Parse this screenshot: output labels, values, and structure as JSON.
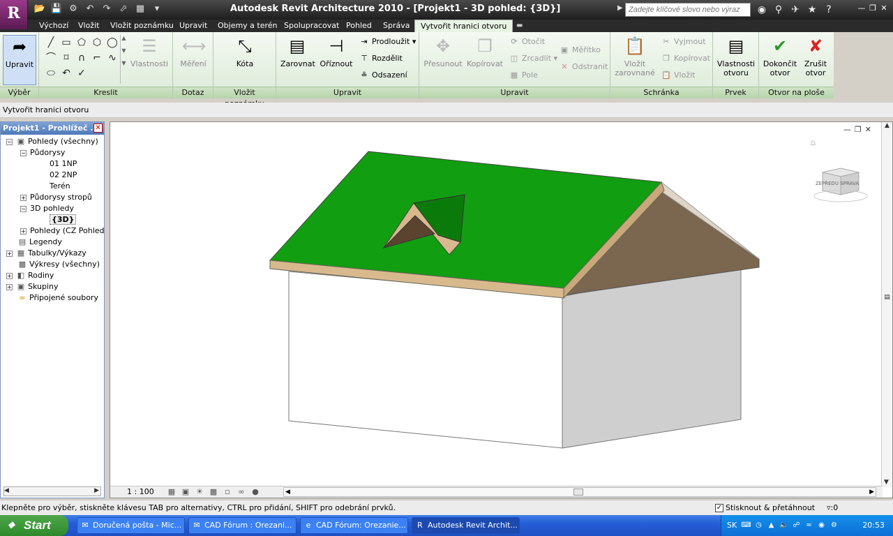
{
  "titlebar": {
    "app_logo": "R",
    "title": "Autodesk Revit Architecture 2010 - [Projekt1 - 3D pohled: {3D}]",
    "search_placeholder": "Zadejte klíčové slovo nebo výraz",
    "icons": [
      "binoculars-icon",
      "key-icon",
      "satellite-icon",
      "star-icon",
      "help-icon"
    ]
  },
  "tabs": [
    {
      "label": "Výchozí",
      "active": false
    },
    {
      "label": "Vložit",
      "active": false
    },
    {
      "label": "Vložit poznámku",
      "active": false
    },
    {
      "label": "Upravit",
      "active": false
    },
    {
      "label": "Objemy a terén",
      "active": false
    },
    {
      "label": "Spolupracovat",
      "active": false
    },
    {
      "label": "Pohled",
      "active": false
    },
    {
      "label": "Správa",
      "active": false
    },
    {
      "label": "Vytvořit hranici otvoru",
      "active": true
    }
  ],
  "ribbon": {
    "select": {
      "label": "Výběr",
      "modify": "Upravit"
    },
    "draw": {
      "label": "Kreslit",
      "properties": "Vlastnosti"
    },
    "inquiry": {
      "label": "Dotaz",
      "measure": "Měření"
    },
    "annotate": {
      "label": "Vložit poznámku",
      "dimension": "Kóta"
    },
    "edit": {
      "label": "Upravit",
      "align": "Zarovnat",
      "trim": "Oříznout",
      "extend": "Prodloužit",
      "split": "Rozdělit",
      "offset": "Odsazení"
    },
    "edit2": {
      "label": "Upravit",
      "move": "Přesunout",
      "copy": "Kopírovat",
      "rotate": "Otočit",
      "mirror": "Zrcadlit",
      "array": "Pole",
      "scale": "Měřítko",
      "delete": "Odstranit"
    },
    "clipboard": {
      "label": "Schránka",
      "paste_aligned": "Vložit zarovnané",
      "cut": "Vyjmout",
      "copy": "Kopírovat",
      "paste": "Vložit"
    },
    "element": {
      "label": "Prvek",
      "properties": "Vlastnosti otvoru"
    },
    "opening": {
      "label": "Otvor na ploše",
      "finish": "Dokončit otvor",
      "cancel": "Zrušit otvor"
    }
  },
  "optionsbar": {
    "text": "Vytvořit hranici otvoru"
  },
  "browser": {
    "title": "Projekt1 - Prohlížeč ...",
    "items": [
      {
        "label": "Pohledy (všechny)",
        "toggle": "−"
      },
      {
        "label": "Půdorysy",
        "toggle": "−"
      },
      {
        "label": "01 1NP"
      },
      {
        "label": "02 2NP"
      },
      {
        "label": "Terén"
      },
      {
        "label": "Půdorysy stropů",
        "toggle": "+"
      },
      {
        "label": "3D pohledy",
        "toggle": "−"
      },
      {
        "label": "{3D}"
      },
      {
        "label": "Pohledy (CZ Pohledy)",
        "toggle": "+"
      },
      {
        "label": "Legendy"
      },
      {
        "label": "Tabulky/Výkazy",
        "toggle": "+"
      },
      {
        "label": "Výkresy (všechny)"
      },
      {
        "label": "Rodiny",
        "toggle": "+"
      },
      {
        "label": "Skupiny",
        "toggle": "+"
      },
      {
        "label": "Připojené soubory"
      }
    ]
  },
  "view": {
    "scale": "1 : 100",
    "viewcube_label": "ZEPŘEDU SPRAVA",
    "colors": {
      "roof": "#119e11",
      "roof_edge": "#d8b98e",
      "opening": "#0a7a0a",
      "wall_front": "#ffffff",
      "wall_side": "#cfcfcf",
      "gable": "#7b6650"
    }
  },
  "status": {
    "text": "Klepněte pro výběr, stiskněte klávesu TAB pro alternativy, CTRL pro přidání, SHIFT pro odebrání prvků.",
    "snap": "Stisknout & přetáhnout",
    "filter": ":0"
  },
  "taskbar": {
    "start": "Start",
    "tasks": [
      {
        "label": "Doručená pošta - Mic...",
        "active": false
      },
      {
        "label": "CAD Fórum : Orezani...",
        "active": false
      },
      {
        "label": "CAD Fórum: Orezanie...",
        "active": false
      },
      {
        "label": "Autodesk Revit Archit...",
        "active": true
      }
    ],
    "lang": "SK",
    "clock": "20:53"
  }
}
